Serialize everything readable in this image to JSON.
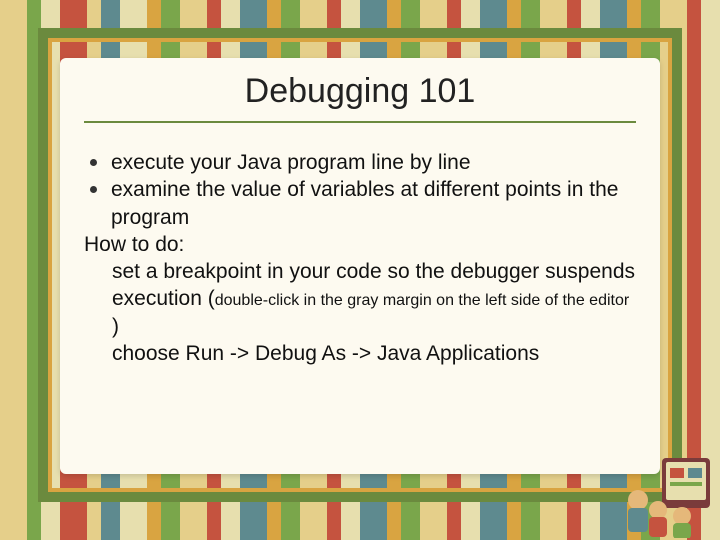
{
  "title": "Debugging 101",
  "bullets": [
    "execute your Java program line by line",
    "examine the value of variables at different points in the program"
  ],
  "howto_label": "How to do:",
  "breakpoint_line_main": "set a breakpoint in your code so the debugger suspends execution (",
  "breakpoint_line_small": "double-click in the gray margin on the left side of the editor",
  "breakpoint_line_close": " )",
  "run_line": "choose Run -> Debug As -> Java Applications",
  "stripe_colors": [
    "#e5cf8a",
    "#7aa64b",
    "#e7dfae",
    "#c5533f",
    "#e5cf8a",
    "#5e8a8f",
    "#e7dfae",
    "#d9a441",
    "#7aa64b",
    "#e5cf8a",
    "#c5533f",
    "#e7dfae",
    "#5e8a8f",
    "#d9a441",
    "#7aa64b",
    "#e5cf8a",
    "#c5533f",
    "#e7dfae",
    "#5e8a8f",
    "#d9a441",
    "#7aa64b",
    "#e5cf8a",
    "#c5533f",
    "#e7dfae",
    "#5e8a8f",
    "#d9a441",
    "#7aa64b",
    "#e5cf8a",
    "#c5533f",
    "#e7dfae",
    "#5e8a8f",
    "#d9a441",
    "#7aa64b",
    "#e5cf8a",
    "#c5533f",
    "#e7dfae"
  ]
}
